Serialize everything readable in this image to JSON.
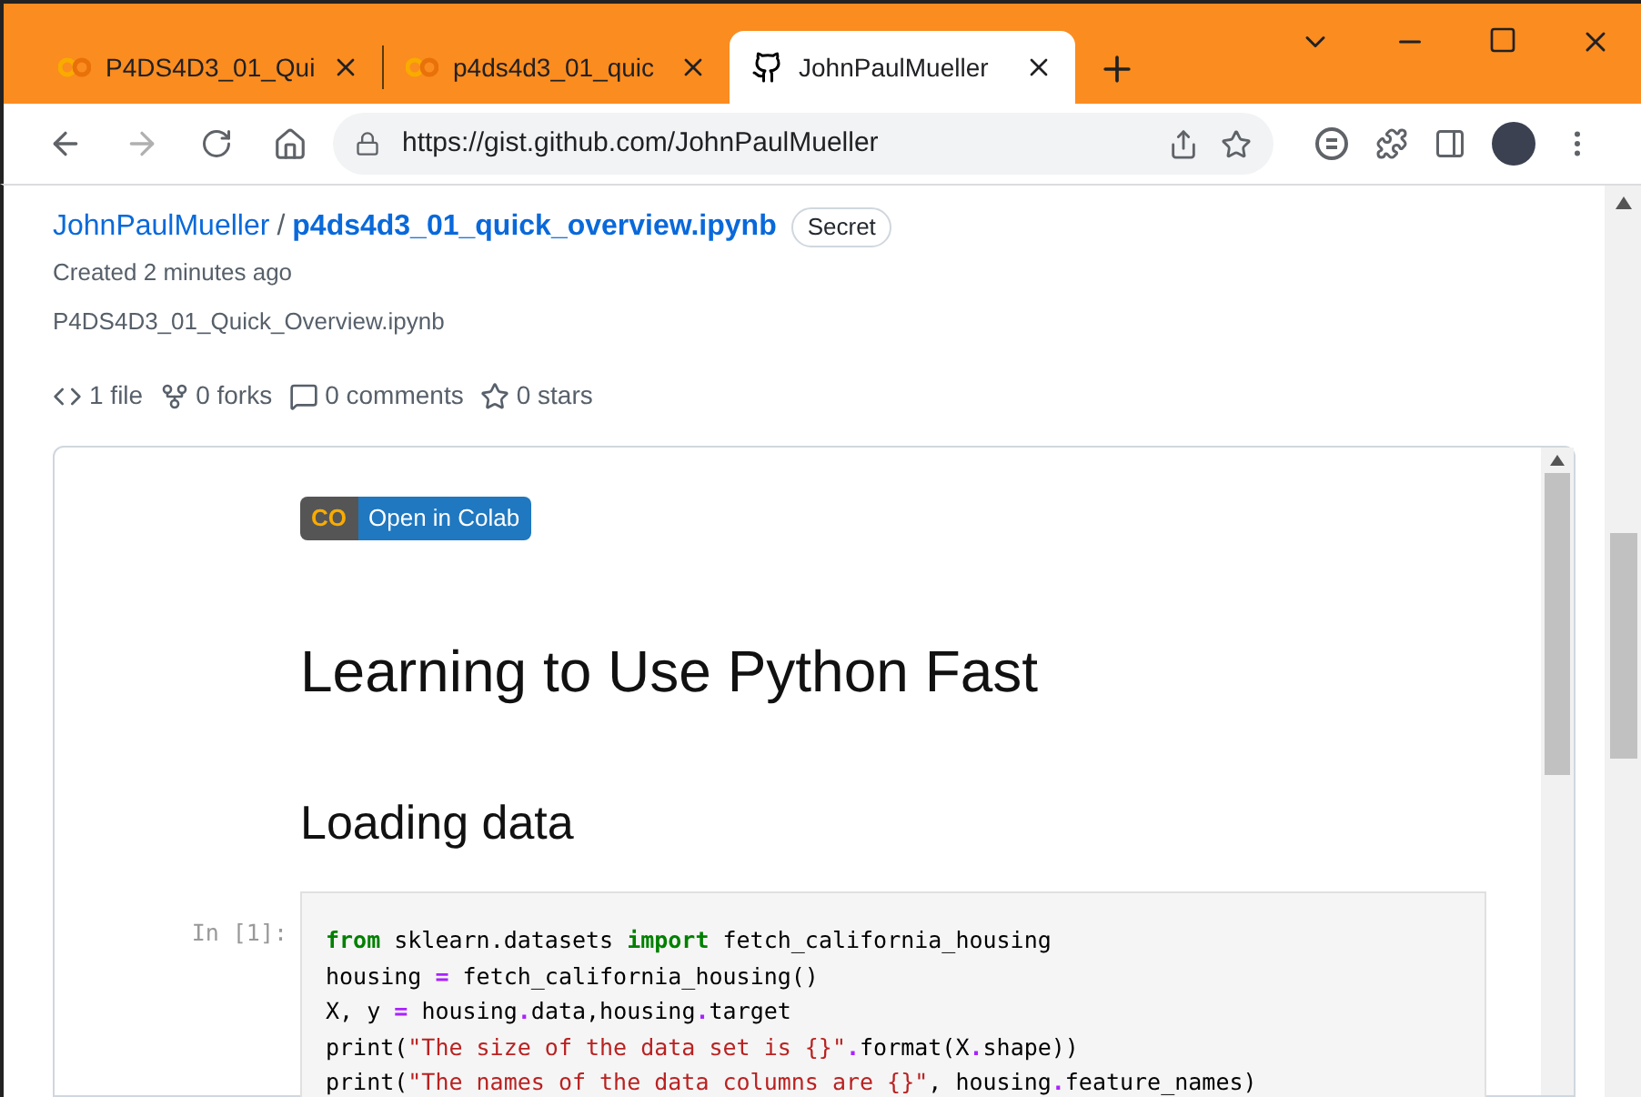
{
  "tabs": [
    {
      "title": "P4DS4D3_01_Qui",
      "kind": "colab",
      "selected": false
    },
    {
      "title": "p4ds4d3_01_quic",
      "kind": "colab",
      "selected": false
    },
    {
      "title": "JohnPaulMueller",
      "kind": "github",
      "selected": true
    }
  ],
  "address_bar": {
    "url": "https://gist.github.com/JohnPaulMueller"
  },
  "gist": {
    "owner": "JohnPaulMueller",
    "separator": "/",
    "name": "p4ds4d3_01_quick_overview.ipynb",
    "badge": "Secret",
    "created": "Created 2 minutes ago",
    "description": "P4DS4D3_01_Quick_Overview.ipynb",
    "stats": [
      {
        "kind": "files",
        "label": "1 file"
      },
      {
        "kind": "forks",
        "label": "0 forks"
      },
      {
        "kind": "comments",
        "label": "0 comments"
      },
      {
        "kind": "stars",
        "label": "0 stars"
      }
    ]
  },
  "notebook": {
    "colab_badge": {
      "logo": "CO",
      "label": "Open in Colab"
    },
    "title": "Learning to Use Python Fast",
    "section": "Loading data",
    "cell": {
      "prompt": "In [1]:",
      "lines": [
        [
          {
            "kind": "kw",
            "text": "from"
          },
          {
            "kind": "plain",
            "text": " sklearn.datasets "
          },
          {
            "kind": "kw",
            "text": "import"
          },
          {
            "kind": "plain",
            "text": " fetch_california_housing"
          }
        ],
        [
          {
            "kind": "plain",
            "text": "housing "
          },
          {
            "kind": "op",
            "text": "="
          },
          {
            "kind": "plain",
            "text": " fetch_california_housing()"
          }
        ],
        [
          {
            "kind": "plain",
            "text": "X, y "
          },
          {
            "kind": "op",
            "text": "="
          },
          {
            "kind": "plain",
            "text": " housing"
          },
          {
            "kind": "op",
            "text": "."
          },
          {
            "kind": "plain",
            "text": "data,housing"
          },
          {
            "kind": "op",
            "text": "."
          },
          {
            "kind": "plain",
            "text": "target"
          }
        ],
        [
          {
            "kind": "plain",
            "text": "print("
          },
          {
            "kind": "str",
            "text": "\"The size of the data set is {}\""
          },
          {
            "kind": "op",
            "text": "."
          },
          {
            "kind": "plain",
            "text": "format(X"
          },
          {
            "kind": "op",
            "text": "."
          },
          {
            "kind": "plain",
            "text": "shape))"
          }
        ],
        [
          {
            "kind": "plain",
            "text": "print("
          },
          {
            "kind": "str",
            "text": "\"The names of the data columns are {}\""
          },
          {
            "kind": "plain",
            "text": ", housing"
          },
          {
            "kind": "op",
            "text": "."
          },
          {
            "kind": "plain",
            "text": "feature_names)"
          }
        ]
      ]
    }
  }
}
